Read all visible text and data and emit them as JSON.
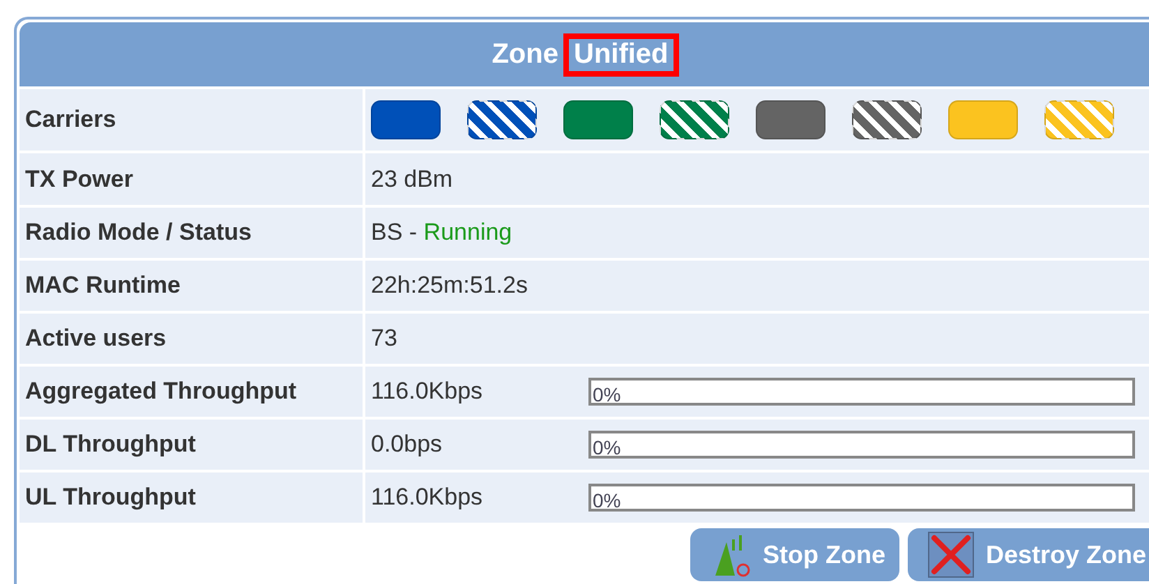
{
  "header": {
    "title": "Zone",
    "highlight": "Unified"
  },
  "carriers": {
    "label": "Carriers",
    "items": [
      {
        "color": "#0050b8",
        "kind": "solid"
      },
      {
        "color": "#0050b8",
        "kind": "striped"
      },
      {
        "color": "#00804a",
        "kind": "solid"
      },
      {
        "color": "#00804a",
        "kind": "striped"
      },
      {
        "color": "#646464",
        "kind": "solid"
      },
      {
        "color": "#646464",
        "kind": "striped"
      },
      {
        "color": "#fbc31f",
        "kind": "solid"
      },
      {
        "color": "#fbc31f",
        "kind": "striped"
      }
    ]
  },
  "rows": [
    {
      "label": "TX Power",
      "value": "23 dBm"
    },
    {
      "label": "Radio Mode / Status",
      "value": "BS -",
      "status": {
        "text": "Running",
        "kind": "running"
      }
    },
    {
      "label": "MAC Runtime",
      "value": "22h:25m:51.2s"
    },
    {
      "label": "Active users",
      "value": "73"
    },
    {
      "label": "Aggregated Throughput",
      "value": "116.0Kbps",
      "meter": {
        "level": 0,
        "reading": "0%"
      }
    },
    {
      "label": "DL Throughput",
      "value": "0.0bps",
      "meter": {
        "level": 0,
        "reading": "0%"
      }
    },
    {
      "label": "UL Throughput",
      "value": "116.0Kbps",
      "meter": {
        "level": 0,
        "reading": "0%"
      }
    }
  ],
  "buttons": [
    {
      "label": "Stop Zone",
      "kind": "stop"
    },
    {
      "label": "Destroy Zone",
      "kind": "destroy"
    }
  ]
}
